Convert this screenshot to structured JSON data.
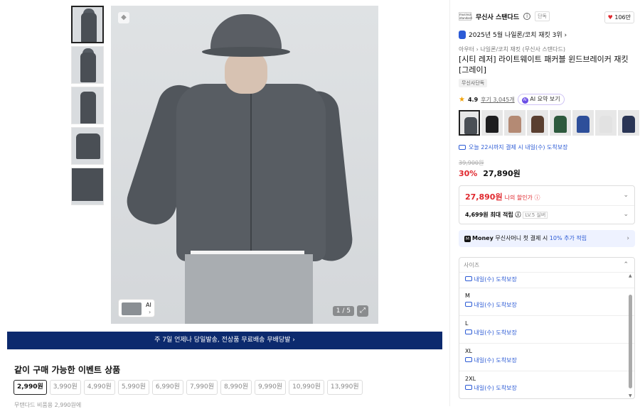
{
  "banner": {
    "text": "주 7일 언제나 당일발송, 전상품 무료배송",
    "extra": "무배당발 ›"
  },
  "events": {
    "title": "같이 구매 가능한 이벤트 상품",
    "prices": [
      "2,990원",
      "3,990원",
      "4,990원",
      "5,990원",
      "6,990원",
      "7,990원",
      "8,990원",
      "9,990원",
      "10,990원",
      "13,990원"
    ],
    "selected_index": 0,
    "footnote": "무탠다드 비품용 2,990원에"
  },
  "gallery": {
    "counter": "1 / 5",
    "ai_label": "AI",
    "ai_chevron": "›",
    "expand_icon": "⤢",
    "tag_icon": "◆"
  },
  "product": {
    "brand": "무신사 스탠다드",
    "brand_logo": "musinsa standard",
    "brand_info": "i",
    "brand_excl": "단독",
    "likes": "106만",
    "rank": "2025년 5월 나일론/코치 재킷 3위 ›",
    "breadcrumb": "아우터 › 나일론/코치 재킷 (무신사 스탠다드)",
    "title": "[시티 레저] 라이트웨이트 패커블 윈드브레이커 재킷 [그레이]",
    "exclusive": "무신사단독",
    "rating": "4.9",
    "reviews": "후기 3,045개",
    "ai_summary": "AI 요약 보기",
    "delivery": "오늘 22시까지 결제 시 내일(수) 도착보장",
    "original_price": "39,900원",
    "discount": "30%",
    "sale_price": "27,890원",
    "my_price": "27,890원",
    "my_price_label": "나의 할인가 ⓘ",
    "points": "4,699원 최대 적립 ⓘ",
    "points_level": "LV.5 실버",
    "money_prefix": "Money",
    "money_text": "무신사머니 첫 결제 시 ",
    "money_pct": "10% 추가 적립",
    "colors": [
      "#4a4f55",
      "#1d1d1f",
      "#b48a74",
      "#5a3f30",
      "#2e5a3e",
      "#2e4f9a",
      "#e2e2e2",
      "#2a3555",
      "#6e7378"
    ]
  },
  "sizes": {
    "header": "사이즈",
    "first_delivery": "내일(수) 도착보장",
    "options": [
      {
        "size": "M",
        "delivery": "내일(수) 도착보장"
      },
      {
        "size": "L",
        "delivery": "내일(수) 도착보장"
      },
      {
        "size": "XL",
        "delivery": "내일(수) 도착보장"
      },
      {
        "size": "2XL",
        "delivery": "내일(수) 도착보장"
      }
    ]
  }
}
